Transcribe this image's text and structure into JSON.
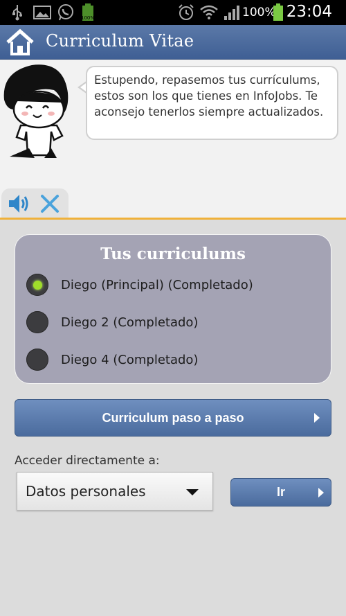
{
  "status_bar": {
    "icons": [
      "usb-icon",
      "image-icon",
      "whatsapp-icon",
      "battery-small-icon",
      "alarm-icon",
      "wifi-icon",
      "signal-icon",
      "battery-icon"
    ],
    "battery_small_label": "100%",
    "battery_percent": "100%",
    "time": "23:04"
  },
  "header": {
    "title": "Curriculum Vitae",
    "home_icon": "home-icon",
    "color": "#4a6b9d"
  },
  "assistant": {
    "message": "Estupendo, repasemos tus currículums, estos son los que tienes en InfoJobs. Te aconsejo tenerlos siempre actualizados.",
    "speaker_icon": "speaker-icon",
    "close_icon": "close-icon"
  },
  "cv_panel": {
    "title": "Tus curriculums",
    "options": [
      {
        "label": "Diego (Principal) (Completado)",
        "selected": true
      },
      {
        "label": "Diego 2 (Completado)",
        "selected": false
      },
      {
        "label": "Diego 4 (Completado)",
        "selected": false
      }
    ]
  },
  "actions": {
    "wizard_button": "Curriculum paso a paso",
    "jump_label": "Acceder directamente a:",
    "jump_select_value": "Datos personales",
    "go_button": "Ir"
  },
  "colors": {
    "accent_line": "#f0b13a",
    "selected_radio": "#9fdc2a",
    "panel_bg": "#a4a3b4"
  }
}
